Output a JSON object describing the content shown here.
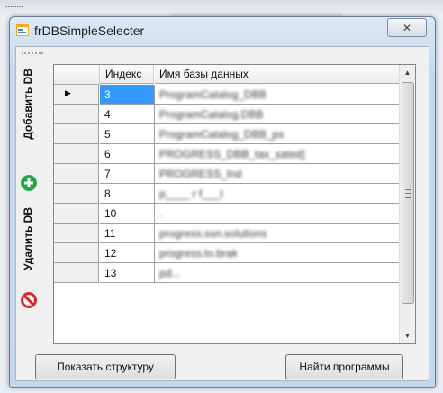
{
  "background": {
    "top_text": "........"
  },
  "window": {
    "title": "frDBSimpleSelecter",
    "close_symbol": "✕"
  },
  "toolbar": {
    "add_label": "Добавить DB",
    "remove_label": "Удалить DB"
  },
  "grid": {
    "columns": [
      "Индекс",
      "Имя базы данных"
    ],
    "rows": [
      {
        "index": "3",
        "name": "ProgramCatalog_DBB",
        "selected": true
      },
      {
        "index": "4",
        "name": "ProgramCatalog.DBB"
      },
      {
        "index": "5",
        "name": "ProgramCatalog_DBB_ps"
      },
      {
        "index": "6",
        "name": "PROGRESS_DBB_tax_sated]"
      },
      {
        "index": "7",
        "name": "PROGRESS_Ind"
      },
      {
        "index": "8",
        "name": "p____ r f___t"
      },
      {
        "index": "10",
        "name": "."
      },
      {
        "index": "11",
        "name": "progress.ssn.solutions"
      },
      {
        "index": "12",
        "name": "progress.to.brak"
      },
      {
        "index": "13",
        "name": "pd..."
      }
    ],
    "current_row_marker": "▶"
  },
  "buttons": {
    "show_structure": "Показать структуру",
    "find_programs": "Найти программы"
  },
  "colors": {
    "selection": "#3399ff",
    "add_icon": "#22a64a",
    "remove_icon": "#d9232e"
  }
}
